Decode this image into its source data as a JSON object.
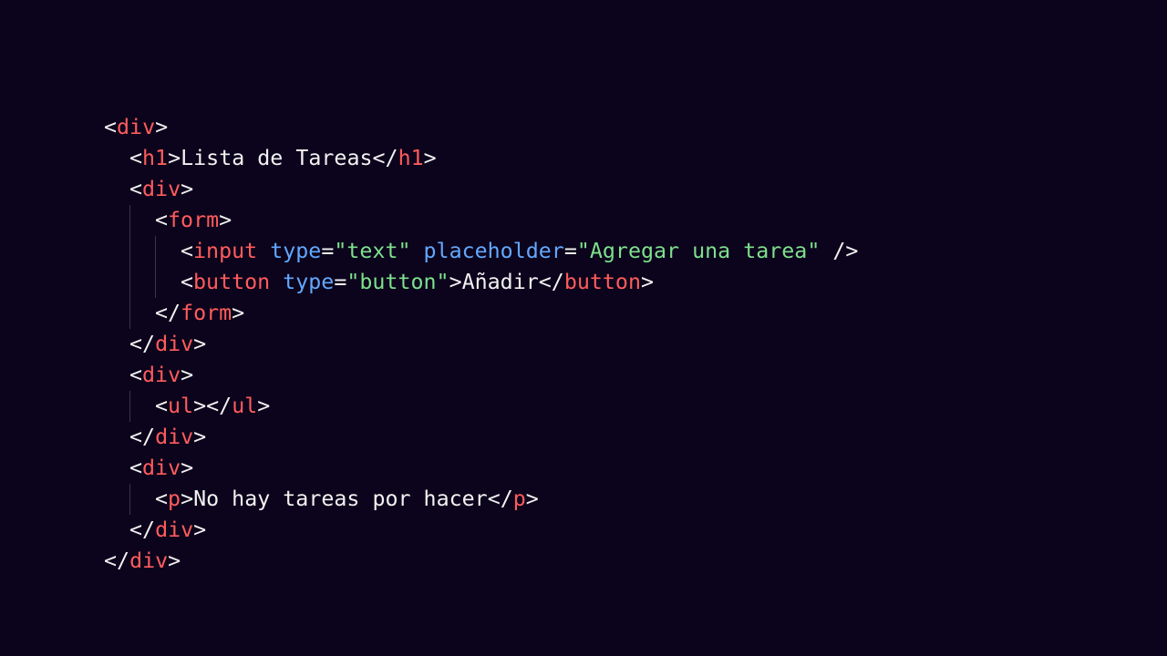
{
  "colors": {
    "background": "#0c041c",
    "punctuation": "#f2f2f2",
    "tag": "#ff5c5c",
    "attribute": "#62a8ff",
    "string": "#7de08c",
    "text": "#f2f2f2"
  },
  "lines": [
    {
      "indent": 0,
      "guides": [],
      "tokens": [
        {
          "t": "<",
          "k": "punctuation"
        },
        {
          "t": "div",
          "k": "tag"
        },
        {
          "t": ">",
          "k": "punctuation"
        }
      ]
    },
    {
      "indent": 1,
      "guides": [],
      "tokens": [
        {
          "t": "<",
          "k": "punctuation"
        },
        {
          "t": "h1",
          "k": "tag"
        },
        {
          "t": ">",
          "k": "punctuation"
        },
        {
          "t": "Lista de Tareas",
          "k": "text"
        },
        {
          "t": "</",
          "k": "punctuation"
        },
        {
          "t": "h1",
          "k": "tag"
        },
        {
          "t": ">",
          "k": "punctuation"
        }
      ]
    },
    {
      "indent": 1,
      "guides": [],
      "tokens": [
        {
          "t": "<",
          "k": "punctuation"
        },
        {
          "t": "div",
          "k": "tag"
        },
        {
          "t": ">",
          "k": "punctuation"
        }
      ]
    },
    {
      "indent": 2,
      "guides": [
        1
      ],
      "tokens": [
        {
          "t": "<",
          "k": "punctuation"
        },
        {
          "t": "form",
          "k": "tag"
        },
        {
          "t": ">",
          "k": "punctuation"
        }
      ]
    },
    {
      "indent": 3,
      "guides": [
        1,
        2
      ],
      "tokens": [
        {
          "t": "<",
          "k": "punctuation"
        },
        {
          "t": "input",
          "k": "tag"
        },
        {
          "t": " ",
          "k": "text"
        },
        {
          "t": "type",
          "k": "attribute"
        },
        {
          "t": "=",
          "k": "punctuation"
        },
        {
          "t": "\"text\"",
          "k": "string"
        },
        {
          "t": " ",
          "k": "text"
        },
        {
          "t": "placeholder",
          "k": "attribute"
        },
        {
          "t": "=",
          "k": "punctuation"
        },
        {
          "t": "\"Agregar una tarea\"",
          "k": "string"
        },
        {
          "t": " />",
          "k": "punctuation"
        }
      ]
    },
    {
      "indent": 3,
      "guides": [
        1,
        2
      ],
      "tokens": [
        {
          "t": "<",
          "k": "punctuation"
        },
        {
          "t": "button",
          "k": "tag"
        },
        {
          "t": " ",
          "k": "text"
        },
        {
          "t": "type",
          "k": "attribute"
        },
        {
          "t": "=",
          "k": "punctuation"
        },
        {
          "t": "\"button\"",
          "k": "string"
        },
        {
          "t": ">",
          "k": "punctuation"
        },
        {
          "t": "Añadir",
          "k": "text"
        },
        {
          "t": "</",
          "k": "punctuation"
        },
        {
          "t": "button",
          "k": "tag"
        },
        {
          "t": ">",
          "k": "punctuation"
        }
      ]
    },
    {
      "indent": 2,
      "guides": [
        1
      ],
      "tokens": [
        {
          "t": "</",
          "k": "punctuation"
        },
        {
          "t": "form",
          "k": "tag"
        },
        {
          "t": ">",
          "k": "punctuation"
        }
      ]
    },
    {
      "indent": 1,
      "guides": [],
      "tokens": [
        {
          "t": "</",
          "k": "punctuation"
        },
        {
          "t": "div",
          "k": "tag"
        },
        {
          "t": ">",
          "k": "punctuation"
        }
      ]
    },
    {
      "indent": 1,
      "guides": [],
      "tokens": [
        {
          "t": "<",
          "k": "punctuation"
        },
        {
          "t": "div",
          "k": "tag"
        },
        {
          "t": ">",
          "k": "punctuation"
        }
      ]
    },
    {
      "indent": 2,
      "guides": [
        1
      ],
      "tokens": [
        {
          "t": "<",
          "k": "punctuation"
        },
        {
          "t": "ul",
          "k": "tag"
        },
        {
          "t": ">",
          "k": "punctuation"
        },
        {
          "t": "</",
          "k": "punctuation"
        },
        {
          "t": "ul",
          "k": "tag"
        },
        {
          "t": ">",
          "k": "punctuation"
        }
      ]
    },
    {
      "indent": 1,
      "guides": [],
      "tokens": [
        {
          "t": "</",
          "k": "punctuation"
        },
        {
          "t": "div",
          "k": "tag"
        },
        {
          "t": ">",
          "k": "punctuation"
        }
      ]
    },
    {
      "indent": 1,
      "guides": [],
      "tokens": [
        {
          "t": "<",
          "k": "punctuation"
        },
        {
          "t": "div",
          "k": "tag"
        },
        {
          "t": ">",
          "k": "punctuation"
        }
      ]
    },
    {
      "indent": 2,
      "guides": [
        1
      ],
      "tokens": [
        {
          "t": "<",
          "k": "punctuation"
        },
        {
          "t": "p",
          "k": "tag"
        },
        {
          "t": ">",
          "k": "punctuation"
        },
        {
          "t": "No hay tareas por hacer",
          "k": "text"
        },
        {
          "t": "</",
          "k": "punctuation"
        },
        {
          "t": "p",
          "k": "tag"
        },
        {
          "t": ">",
          "k": "punctuation"
        }
      ]
    },
    {
      "indent": 1,
      "guides": [],
      "tokens": [
        {
          "t": "</",
          "k": "punctuation"
        },
        {
          "t": "div",
          "k": "tag"
        },
        {
          "t": ">",
          "k": "punctuation"
        }
      ]
    },
    {
      "indent": 0,
      "guides": [],
      "tokens": [
        {
          "t": "</",
          "k": "punctuation"
        },
        {
          "t": "div",
          "k": "tag"
        },
        {
          "t": ">",
          "k": "punctuation"
        }
      ]
    }
  ]
}
